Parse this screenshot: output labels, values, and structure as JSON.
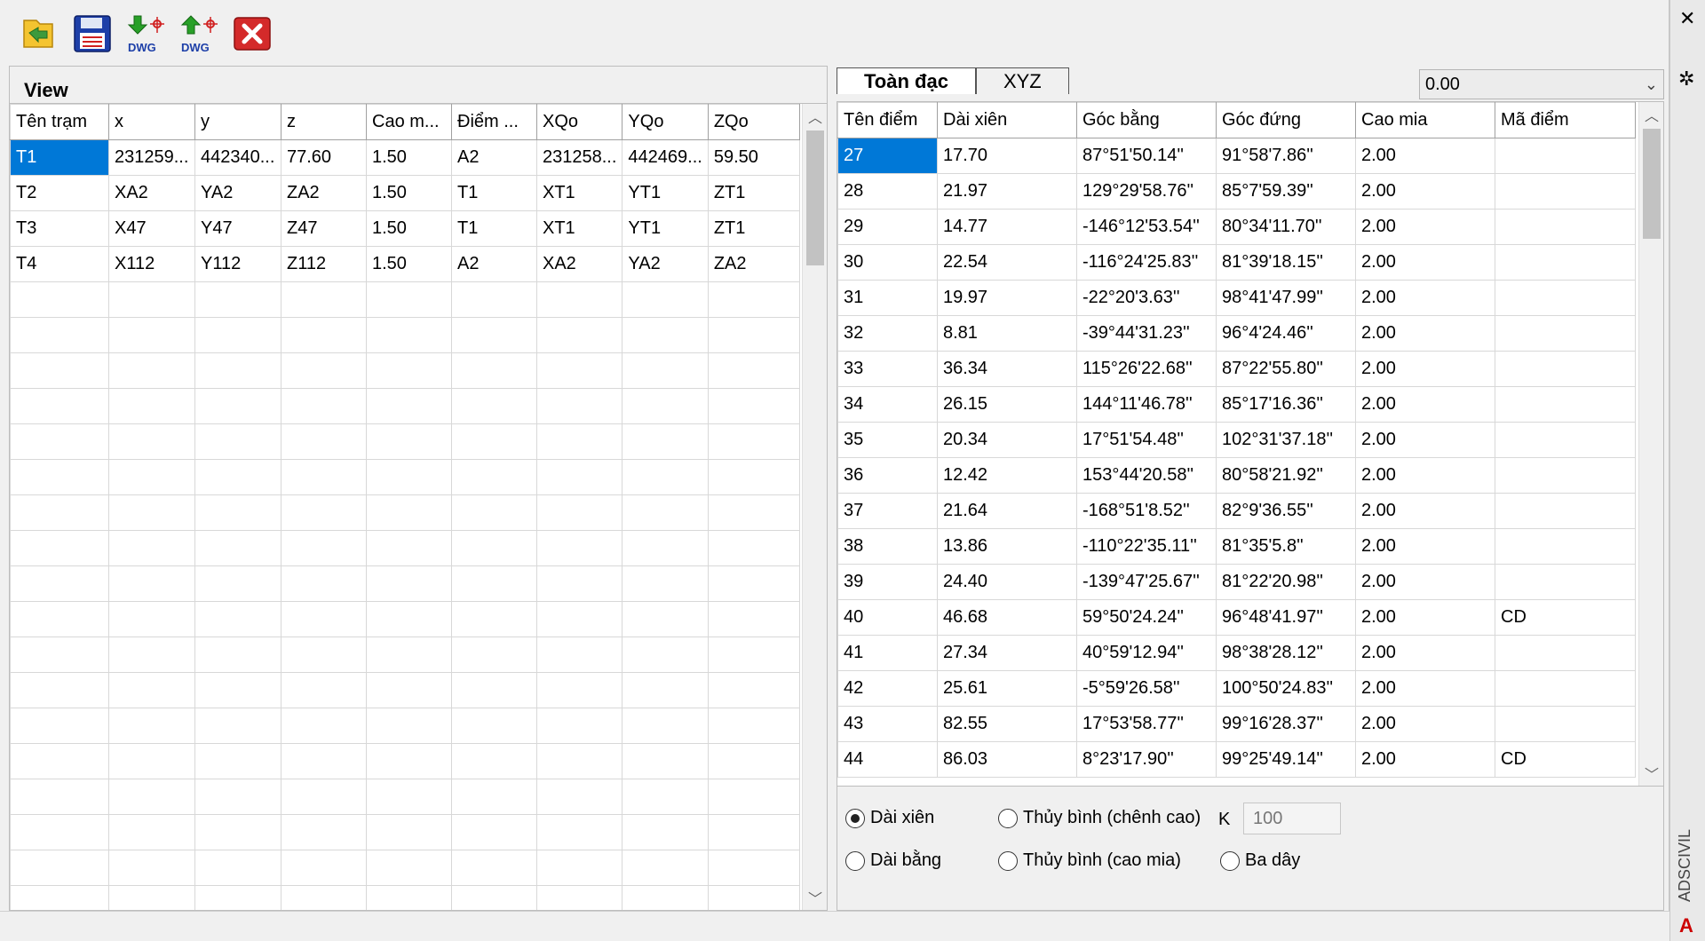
{
  "toolbar": {
    "open_icon": "folder-open-icon",
    "save_icon": "floppy-disk-icon",
    "import_dwg_label": "DWG",
    "export_dwg_label": "DWG",
    "close_icon": "red-close-icon"
  },
  "left": {
    "view_label": "View",
    "columns": [
      "Tên trạm",
      "x",
      "y",
      "z",
      "Cao m...",
      "Điểm ...",
      "XQo",
      "YQo",
      "ZQo"
    ],
    "rows": [
      [
        "T1",
        "231259...",
        "442340...",
        "77.60",
        "1.50",
        "A2",
        "231258...",
        "442469...",
        "59.50"
      ],
      [
        "T2",
        "XA2",
        "YA2",
        "ZA2",
        "1.50",
        "T1",
        "XT1",
        "YT1",
        "ZT1"
      ],
      [
        "T3",
        "X47",
        "Y47",
        "Z47",
        "1.50",
        "T1",
        "XT1",
        "YT1",
        "ZT1"
      ],
      [
        "T4",
        "X112",
        "Y112",
        "Z112",
        "1.50",
        "A2",
        "XA2",
        "YA2",
        "ZA2"
      ]
    ],
    "empty_rows": 18
  },
  "right": {
    "tabs": [
      "Toàn đạc",
      "XYZ"
    ],
    "combo_value": "0.00",
    "columns": [
      "Tên điểm",
      "Dài xiên",
      "Góc bằng",
      "Góc đứng",
      "Cao mia",
      "Mã điểm"
    ],
    "rows": [
      [
        "27",
        "17.70",
        "87°51'50.14''",
        "91°58'7.86''",
        "2.00",
        ""
      ],
      [
        "28",
        "21.97",
        "129°29'58.76''",
        "85°7'59.39''",
        "2.00",
        ""
      ],
      [
        "29",
        "14.77",
        "-146°12'53.54''",
        "80°34'11.70''",
        "2.00",
        ""
      ],
      [
        "30",
        "22.54",
        "-116°24'25.83''",
        "81°39'18.15''",
        "2.00",
        ""
      ],
      [
        "31",
        "19.97",
        "-22°20'3.63''",
        "98°41'47.99''",
        "2.00",
        ""
      ],
      [
        "32",
        "8.81",
        "-39°44'31.23''",
        "96°4'24.46''",
        "2.00",
        ""
      ],
      [
        "33",
        "36.34",
        "115°26'22.68''",
        "87°22'55.80''",
        "2.00",
        ""
      ],
      [
        "34",
        "26.15",
        "144°11'46.78''",
        "85°17'16.36''",
        "2.00",
        ""
      ],
      [
        "35",
        "20.34",
        "17°51'54.48''",
        "102°31'37.18''",
        "2.00",
        ""
      ],
      [
        "36",
        "12.42",
        "153°44'20.58''",
        "80°58'21.92''",
        "2.00",
        ""
      ],
      [
        "37",
        "21.64",
        "-168°51'8.52''",
        "82°9'36.55''",
        "2.00",
        ""
      ],
      [
        "38",
        "13.86",
        "-110°22'35.11''",
        "81°35'5.8''",
        "2.00",
        ""
      ],
      [
        "39",
        "24.40",
        "-139°47'25.67''",
        "81°22'20.98''",
        "2.00",
        ""
      ],
      [
        "40",
        "46.68",
        "59°50'24.24''",
        "96°48'41.97''",
        "2.00",
        "CD"
      ],
      [
        "41",
        "27.34",
        "40°59'12.94''",
        "98°38'28.12''",
        "2.00",
        ""
      ],
      [
        "42",
        "25.61",
        "-5°59'26.58''",
        "100°50'24.83''",
        "2.00",
        ""
      ],
      [
        "43",
        "82.55",
        "17°53'58.77''",
        "99°16'28.37''",
        "2.00",
        ""
      ],
      [
        "44",
        "86.03",
        "8°23'17.90''",
        "99°25'49.14''",
        "2.00",
        "CD"
      ]
    ]
  },
  "options": {
    "radio_dai_xien": "Dài xiên",
    "radio_thuy_binh_chenh_cao": "Thủy bình (chênh cao)",
    "radio_dai_bang": "Dài bằng",
    "radio_thuy_binh_cao_mia": "Thủy bình (cao mia)",
    "radio_ba_day": "Ba dây",
    "k_label": "K",
    "k_value": "100",
    "selected": "Dài xiên"
  },
  "side": {
    "label": "ADSCIVIL",
    "logo": "A"
  }
}
